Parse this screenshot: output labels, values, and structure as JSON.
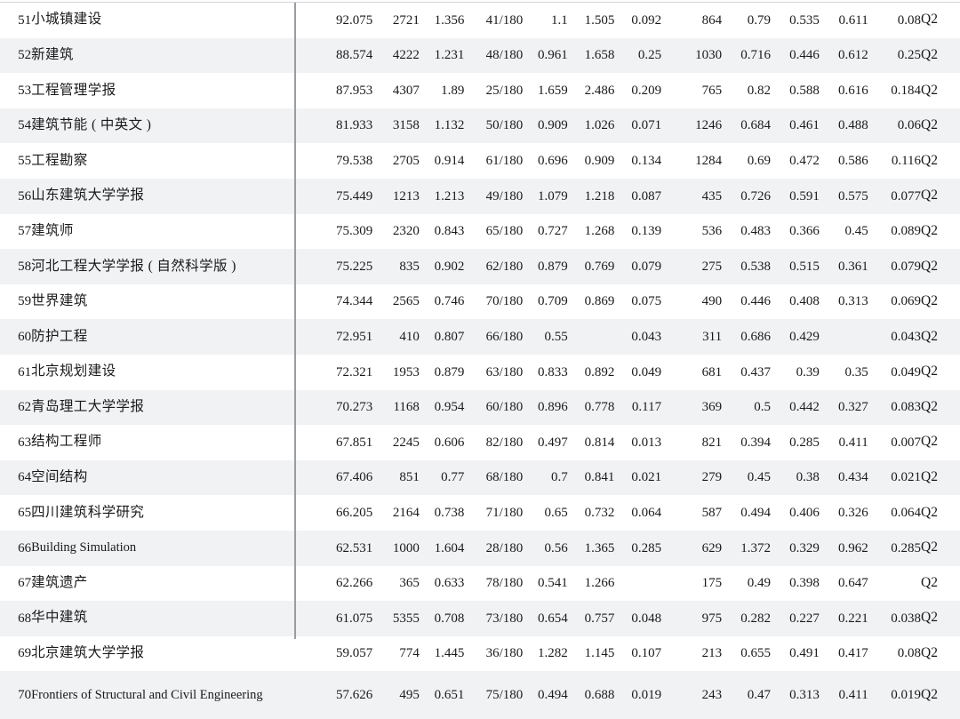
{
  "table": {
    "columns": [
      {
        "key": "rank",
        "name": "rank-number"
      },
      {
        "key": "name",
        "name": "journal-name"
      },
      {
        "key": "score",
        "name": "composite-score"
      },
      {
        "key": "pub",
        "name": "publication-count"
      },
      {
        "key": "if",
        "name": "impact-factor"
      },
      {
        "key": "rankfrac",
        "name": "category-rank"
      },
      {
        "key": "m1",
        "name": "metric-1"
      },
      {
        "key": "m2",
        "name": "metric-2"
      },
      {
        "key": "m3",
        "name": "metric-3"
      },
      {
        "key": "cites",
        "name": "citation-count"
      },
      {
        "key": "m4",
        "name": "metric-4"
      },
      {
        "key": "m5",
        "name": "metric-5"
      },
      {
        "key": "m6",
        "name": "metric-6"
      },
      {
        "key": "m7",
        "name": "metric-7"
      },
      {
        "key": "q",
        "name": "quartile"
      }
    ],
    "rows": [
      {
        "rank": "51",
        "name": "小城镇建设",
        "script": "cjk",
        "score": "92.075",
        "pub": "2721",
        "if": "1.356",
        "rankfrac": "41/180",
        "m1": "1.1",
        "m2": "1.505",
        "m3": "0.092",
        "cites": "864",
        "m4": "0.79",
        "m5": "0.535",
        "m6": "0.611",
        "m7": "0.08",
        "q": "Q2"
      },
      {
        "rank": "52",
        "name": "新建筑",
        "script": "cjk",
        "score": "88.574",
        "pub": "4222",
        "if": "1.231",
        "rankfrac": "48/180",
        "m1": "0.961",
        "m2": "1.658",
        "m3": "0.25",
        "cites": "1030",
        "m4": "0.716",
        "m5": "0.446",
        "m6": "0.612",
        "m7": "0.25",
        "q": "Q2"
      },
      {
        "rank": "53",
        "name": "工程管理学报",
        "script": "cjk",
        "score": "87.953",
        "pub": "4307",
        "if": "1.89",
        "rankfrac": "25/180",
        "m1": "1.659",
        "m2": "2.486",
        "m3": "0.209",
        "cites": "765",
        "m4": "0.82",
        "m5": "0.588",
        "m6": "0.616",
        "m7": "0.184",
        "q": "Q2"
      },
      {
        "rank": "54",
        "name": "建筑节能 ( 中英文 )",
        "script": "cjk",
        "score": "81.933",
        "pub": "3158",
        "if": "1.132",
        "rankfrac": "50/180",
        "m1": "0.909",
        "m2": "1.026",
        "m3": "0.071",
        "cites": "1246",
        "m4": "0.684",
        "m5": "0.461",
        "m6": "0.488",
        "m7": "0.06",
        "q": "Q2"
      },
      {
        "rank": "55",
        "name": "工程勘察",
        "script": "cjk",
        "score": "79.538",
        "pub": "2705",
        "if": "0.914",
        "rankfrac": "61/180",
        "m1": "0.696",
        "m2": "0.909",
        "m3": "0.134",
        "cites": "1284",
        "m4": "0.69",
        "m5": "0.472",
        "m6": "0.586",
        "m7": "0.116",
        "q": "Q2"
      },
      {
        "rank": "56",
        "name": "山东建筑大学学报",
        "script": "cjk",
        "score": "75.449",
        "pub": "1213",
        "if": "1.213",
        "rankfrac": "49/180",
        "m1": "1.079",
        "m2": "1.218",
        "m3": "0.087",
        "cites": "435",
        "m4": "0.726",
        "m5": "0.591",
        "m6": "0.575",
        "m7": "0.077",
        "q": "Q2"
      },
      {
        "rank": "57",
        "name": "建筑师",
        "script": "cjk",
        "score": "75.309",
        "pub": "2320",
        "if": "0.843",
        "rankfrac": "65/180",
        "m1": "0.727",
        "m2": "1.268",
        "m3": "0.139",
        "cites": "536",
        "m4": "0.483",
        "m5": "0.366",
        "m6": "0.45",
        "m7": "0.089",
        "q": "Q2"
      },
      {
        "rank": "58",
        "name": "河北工程大学学报 ( 自然科学版 )",
        "script": "cjk",
        "score": "75.225",
        "pub": "835",
        "if": "0.902",
        "rankfrac": "62/180",
        "m1": "0.879",
        "m2": "0.769",
        "m3": "0.079",
        "cites": "275",
        "m4": "0.538",
        "m5": "0.515",
        "m6": "0.361",
        "m7": "0.079",
        "q": "Q2"
      },
      {
        "rank": "59",
        "name": "世界建筑",
        "script": "cjk",
        "score": "74.344",
        "pub": "2565",
        "if": "0.746",
        "rankfrac": "70/180",
        "m1": "0.709",
        "m2": "0.869",
        "m3": "0.075",
        "cites": "490",
        "m4": "0.446",
        "m5": "0.408",
        "m6": "0.313",
        "m7": "0.069",
        "q": "Q2"
      },
      {
        "rank": "60",
        "name": "防护工程",
        "script": "cjk",
        "score": "72.951",
        "pub": "410",
        "if": "0.807",
        "rankfrac": "66/180",
        "m1": "0.55",
        "m2": "",
        "m3": "0.043",
        "cites": "311",
        "m4": "0.686",
        "m5": "0.429",
        "m6": "",
        "m7": "0.043",
        "q": "Q2"
      },
      {
        "rank": "61",
        "name": "北京规划建设",
        "script": "cjk",
        "score": "72.321",
        "pub": "1953",
        "if": "0.879",
        "rankfrac": "63/180",
        "m1": "0.833",
        "m2": "0.892",
        "m3": "0.049",
        "cites": "681",
        "m4": "0.437",
        "m5": "0.39",
        "m6": "0.35",
        "m7": "0.049",
        "q": "Q2"
      },
      {
        "rank": "62",
        "name": "青岛理工大学学报",
        "script": "cjk",
        "score": "70.273",
        "pub": "1168",
        "if": "0.954",
        "rankfrac": "60/180",
        "m1": "0.896",
        "m2": "0.778",
        "m3": "0.117",
        "cites": "369",
        "m4": "0.5",
        "m5": "0.442",
        "m6": "0.327",
        "m7": "0.083",
        "q": "Q2"
      },
      {
        "rank": "63",
        "name": "结构工程师",
        "script": "cjk",
        "score": "67.851",
        "pub": "2245",
        "if": "0.606",
        "rankfrac": "82/180",
        "m1": "0.497",
        "m2": "0.814",
        "m3": "0.013",
        "cites": "821",
        "m4": "0.394",
        "m5": "0.285",
        "m6": "0.411",
        "m7": "0.007",
        "q": "Q2"
      },
      {
        "rank": "64",
        "name": "空间结构",
        "script": "cjk",
        "score": "67.406",
        "pub": "851",
        "if": "0.77",
        "rankfrac": "68/180",
        "m1": "0.7",
        "m2": "0.841",
        "m3": "0.021",
        "cites": "279",
        "m4": "0.45",
        "m5": "0.38",
        "m6": "0.434",
        "m7": "0.021",
        "q": "Q2"
      },
      {
        "rank": "65",
        "name": "四川建筑科学研究",
        "script": "cjk",
        "score": "66.205",
        "pub": "2164",
        "if": "0.738",
        "rankfrac": "71/180",
        "m1": "0.65",
        "m2": "0.732",
        "m3": "0.064",
        "cites": "587",
        "m4": "0.494",
        "m5": "0.406",
        "m6": "0.326",
        "m7": "0.064",
        "q": "Q2"
      },
      {
        "rank": "66",
        "name": "Building Simulation",
        "script": "latin",
        "score": "62.531",
        "pub": "1000",
        "if": "1.604",
        "rankfrac": "28/180",
        "m1": "0.56",
        "m2": "1.365",
        "m3": "0.285",
        "cites": "629",
        "m4": "1.372",
        "m5": "0.329",
        "m6": "0.962",
        "m7": "0.285",
        "q": "Q2"
      },
      {
        "rank": "67",
        "name": "建筑遗产",
        "script": "cjk",
        "score": "62.266",
        "pub": "365",
        "if": "0.633",
        "rankfrac": "78/180",
        "m1": "0.541",
        "m2": "1.266",
        "m3": "",
        "cites": "175",
        "m4": "0.49",
        "m5": "0.398",
        "m6": "0.647",
        "m7": "",
        "q": "Q2"
      },
      {
        "rank": "68",
        "name": "华中建筑",
        "script": "cjk",
        "score": "61.075",
        "pub": "5355",
        "if": "0.708",
        "rankfrac": "73/180",
        "m1": "0.654",
        "m2": "0.757",
        "m3": "0.048",
        "cites": "975",
        "m4": "0.282",
        "m5": "0.227",
        "m6": "0.221",
        "m7": "0.038",
        "q": "Q2"
      },
      {
        "rank": "69",
        "name": "北京建筑大学学报",
        "script": "cjk",
        "score": "59.057",
        "pub": "774",
        "if": "1.445",
        "rankfrac": "36/180",
        "m1": "1.282",
        "m2": "1.145",
        "m3": "0.107",
        "cites": "213",
        "m4": "0.655",
        "m5": "0.491",
        "m6": "0.417",
        "m7": "0.08",
        "q": "Q2"
      },
      {
        "rank": "70",
        "name": "Frontiers of Structural and Civil Engineering",
        "script": "latin",
        "score": "57.626",
        "pub": "495",
        "if": "0.651",
        "rankfrac": "75/180",
        "m1": "0.494",
        "m2": "0.688",
        "m3": "0.019",
        "cites": "243",
        "m4": "0.47",
        "m5": "0.313",
        "m6": "0.411",
        "m7": "0.019",
        "q": "Q2"
      }
    ]
  },
  "style": {
    "row_even_bg": "#f1f2f4",
    "row_odd_bg": "#ffffff",
    "divider_color": "#9a9da3",
    "rule_color": "#d2d4d8",
    "text_color": "#1a1a1a"
  }
}
